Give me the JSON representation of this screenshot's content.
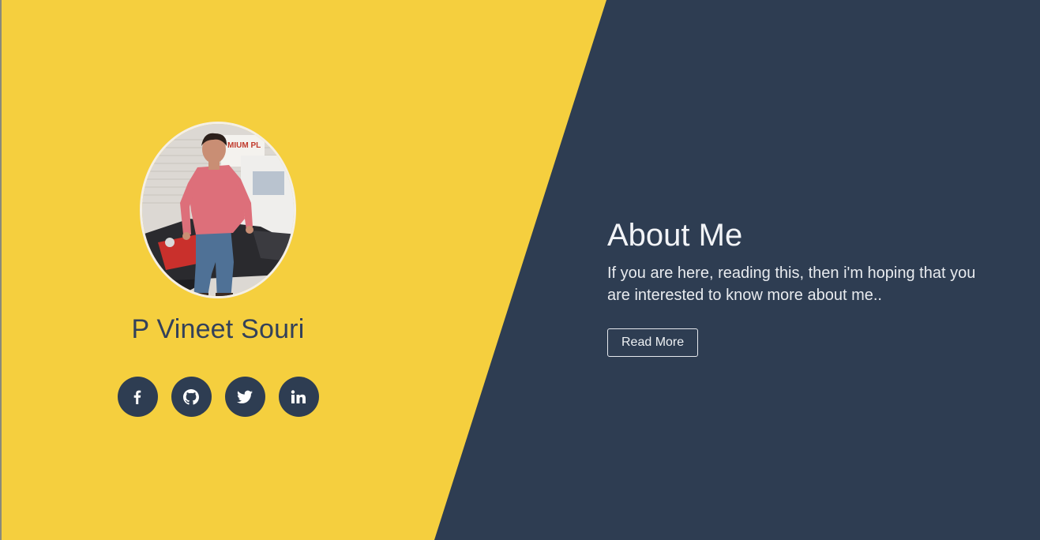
{
  "profile": {
    "name": "P Vineet Souri",
    "photo_alt": "Profile photo of person sitting on a motorcycle",
    "sign_text": "MIUM PL"
  },
  "socials": [
    {
      "name": "facebook",
      "icon": "facebook-icon",
      "glyph": "f"
    },
    {
      "name": "github",
      "icon": "github-icon"
    },
    {
      "name": "twitter",
      "icon": "twitter-icon"
    },
    {
      "name": "linkedin",
      "icon": "linkedin-icon",
      "glyph": "in"
    }
  ],
  "about": {
    "title": "About Me",
    "text": "If you are here, reading this, then i'm hoping that you are interested to know more about me..",
    "button_label": "Read More"
  },
  "colors": {
    "yellow": "#f5cf3e",
    "dark": "#2e3d52",
    "name_text": "#33415a"
  }
}
